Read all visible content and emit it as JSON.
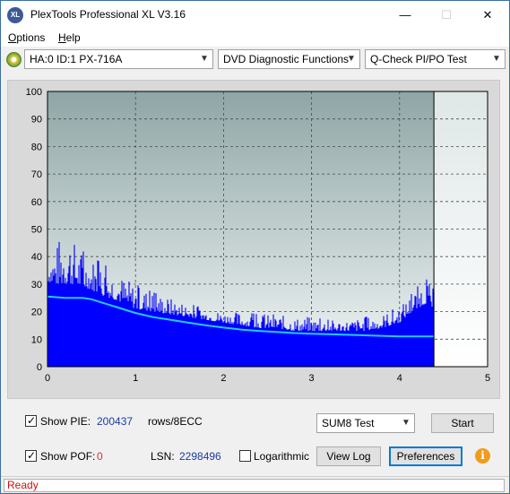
{
  "window": {
    "title": "PlexTools Professional XL V3.16",
    "app_icon_text": "XL",
    "min_glyph": "—",
    "max_glyph": "☐",
    "close_glyph": "✕"
  },
  "menu": {
    "items": [
      {
        "label_ul": "O",
        "label_rest": "ptions"
      },
      {
        "label_ul": "H",
        "label_rest": "elp"
      }
    ]
  },
  "toolbar": {
    "drive": "HA:0 ID:1  PX-716A",
    "function": "DVD Diagnostic Functions",
    "test": "Q-Check PI/PO Test"
  },
  "controls": {
    "show_pie_label": "Show PIE:",
    "pie_value": "200437",
    "pie_unit": "rows/8ECC",
    "show_pof_label": "Show POF:",
    "pof_value": "0",
    "lsn_label": "LSN:",
    "lsn_value": "2298496",
    "logarithmic_label": "Logarithmic",
    "sum_select": "SUM8 Test",
    "start_button": "Start",
    "view_log_button": "View Log",
    "preferences_button": "Preferences"
  },
  "status": {
    "text": "Ready"
  },
  "chart_data": {
    "type": "area",
    "xlabel": "",
    "ylabel": "",
    "xlim": [
      0,
      5
    ],
    "ylim": [
      0,
      100
    ],
    "x_ticks": [
      "0",
      "1",
      "2",
      "3",
      "4",
      "5"
    ],
    "y_ticks": [
      "0",
      "10",
      "20",
      "30",
      "40",
      "50",
      "60",
      "70",
      "80",
      "90",
      "100"
    ],
    "grid": true,
    "end_marker_x": 4.39,
    "series": [
      {
        "kind": "bars",
        "color": "#0000ff",
        "x": [
          0.0,
          0.1,
          0.2,
          0.3,
          0.4,
          0.5,
          0.6,
          0.8,
          1.0,
          1.2,
          1.4,
          1.6,
          1.8,
          2.0,
          2.2,
          2.4,
          2.6,
          2.8,
          3.0,
          3.2,
          3.4,
          3.6,
          3.8,
          4.0,
          4.1,
          4.2,
          4.3,
          4.39
        ],
        "peak": [
          41,
          44,
          53,
          46,
          42,
          40,
          38,
          34,
          30,
          27,
          25,
          23,
          21,
          20,
          20,
          19,
          19,
          18,
          18,
          17,
          17,
          18,
          19,
          22,
          25,
          29,
          32,
          28
        ],
        "base": [
          31,
          30,
          30,
          30,
          29,
          28,
          26,
          24,
          21,
          20,
          19,
          18,
          17,
          16,
          15,
          14,
          14,
          13,
          13,
          13,
          13,
          13,
          14,
          16,
          19,
          21,
          23,
          21
        ]
      },
      {
        "kind": "line",
        "color": "#22ccff",
        "x": [
          0.0,
          0.2,
          0.4,
          0.5,
          0.6,
          0.8,
          1.0,
          1.2,
          1.4,
          1.6,
          1.8,
          2.0,
          2.2,
          2.4,
          2.6,
          2.8,
          3.0,
          3.2,
          3.4,
          3.6,
          3.8,
          4.0,
          4.2,
          4.39
        ],
        "y": [
          25.5,
          25,
          25,
          24.5,
          23.5,
          21.5,
          19.5,
          18,
          17,
          16,
          15,
          14.2,
          13.5,
          13,
          12.6,
          12.2,
          12,
          11.8,
          11.6,
          11.4,
          11.2,
          11,
          11,
          11
        ]
      }
    ]
  }
}
